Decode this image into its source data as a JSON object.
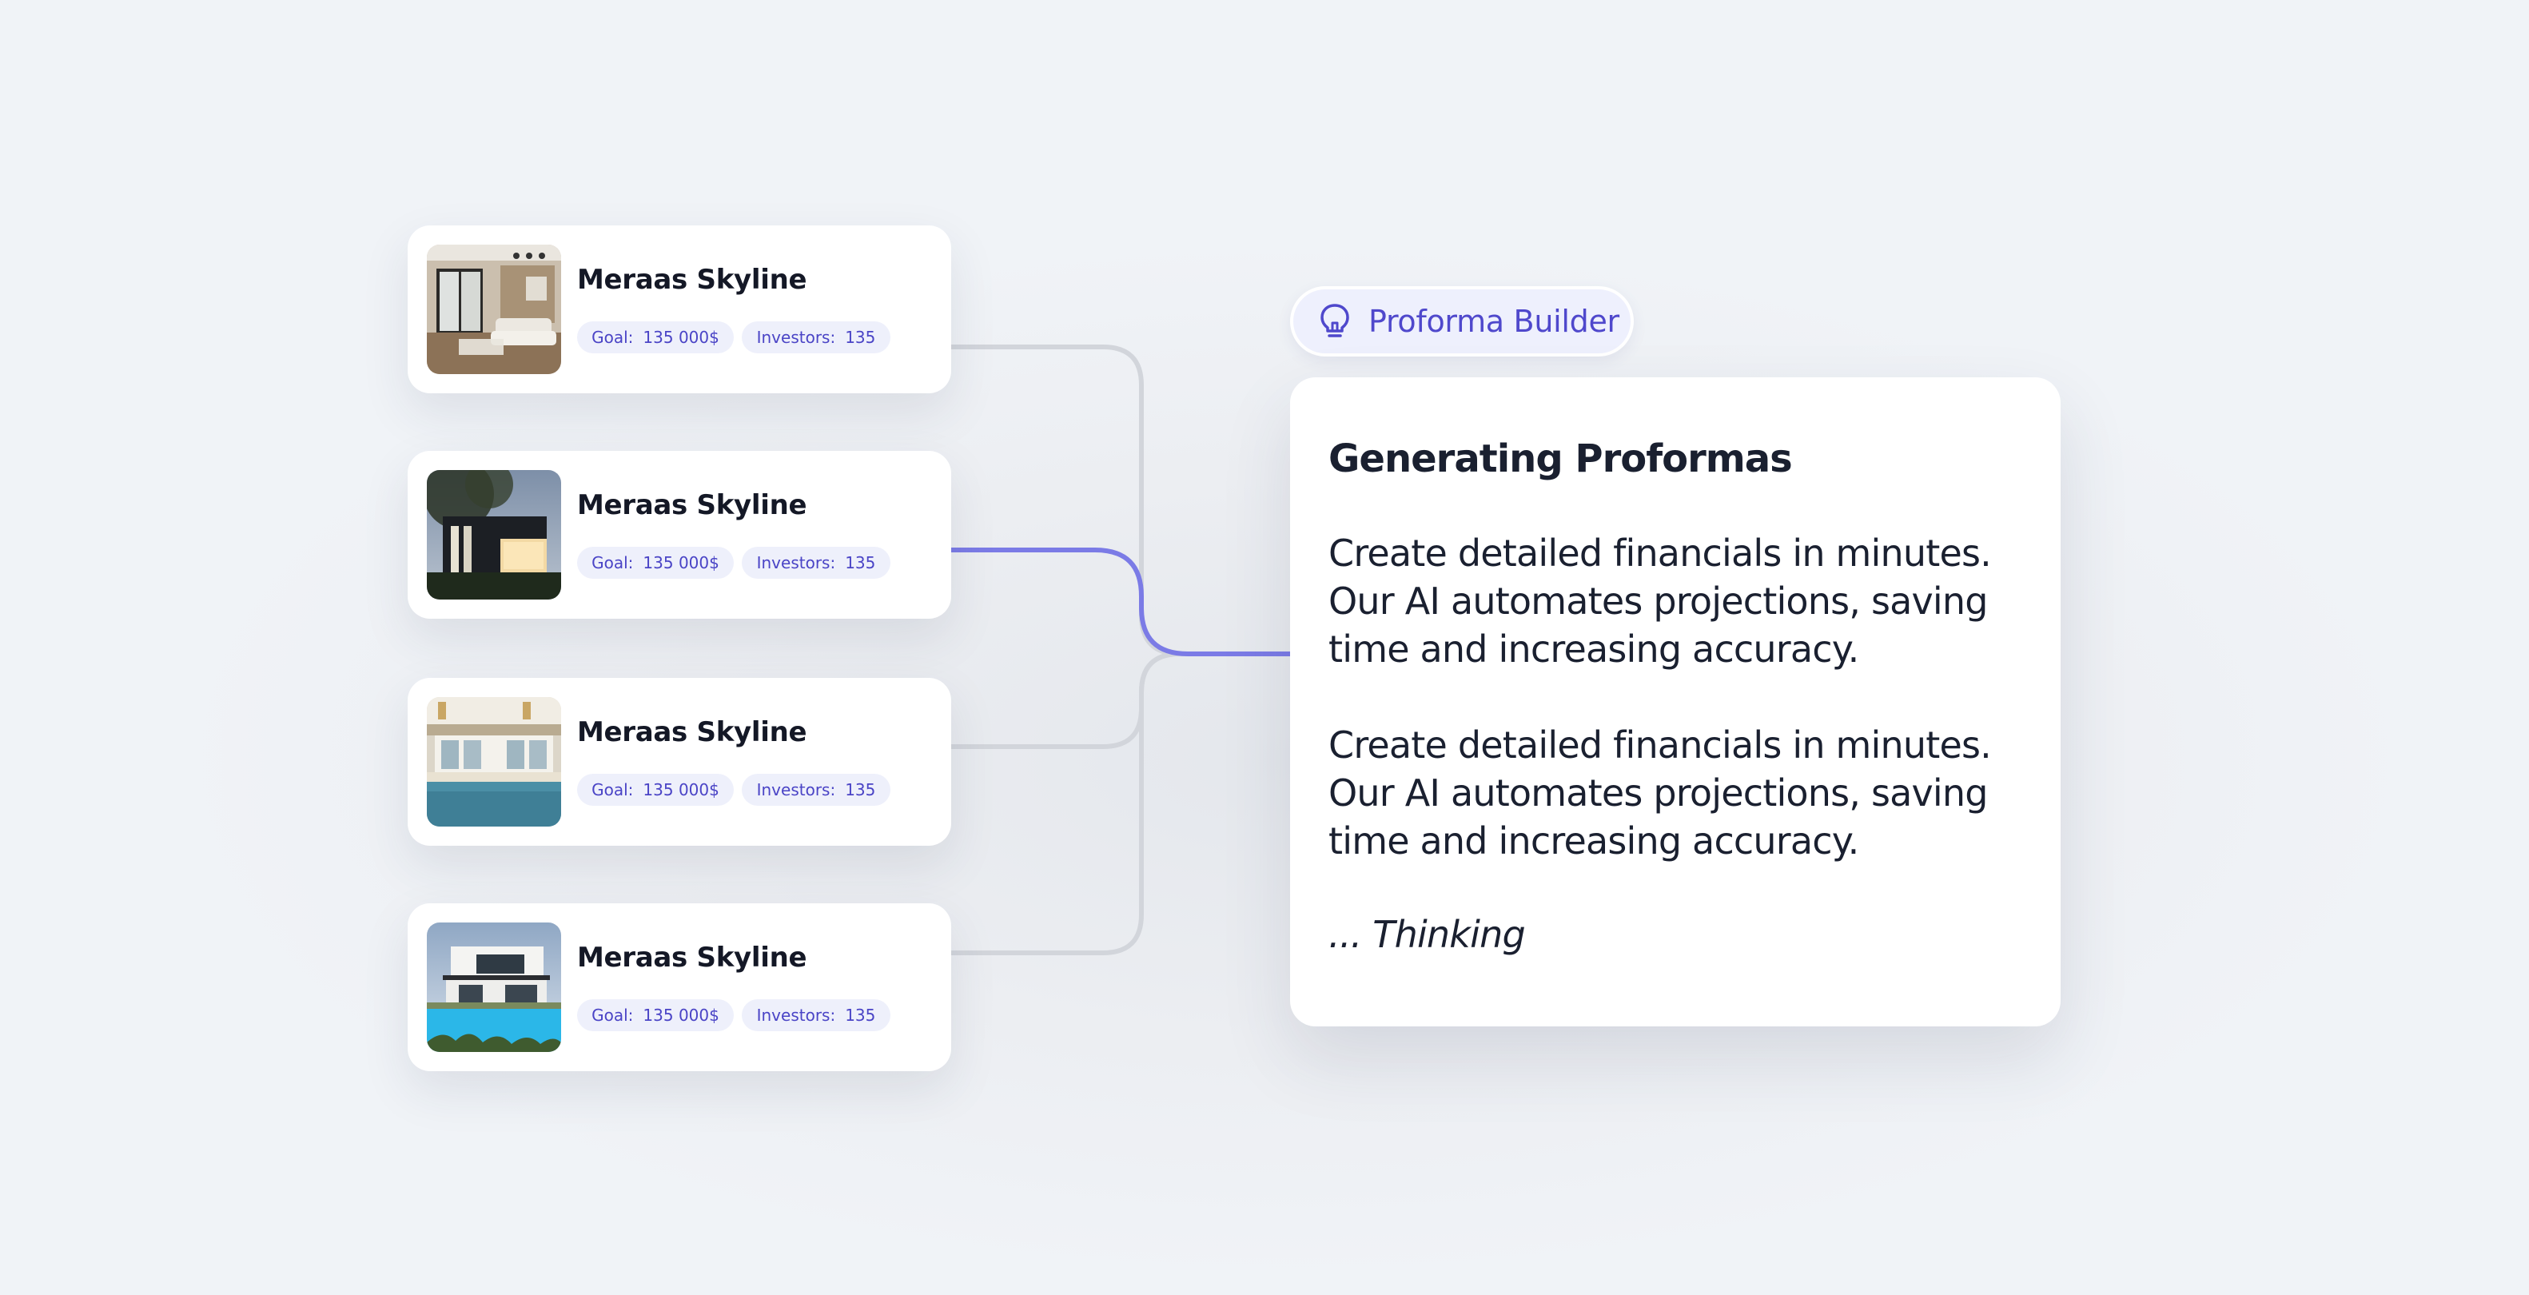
{
  "colors": {
    "accent": "#7b7be6",
    "connector_muted": "#d2d5db",
    "pill_background": "#eef0fb",
    "pill_text": "#4a44c6",
    "badge_text": "#4f48cc",
    "title_text": "#141826"
  },
  "properties": [
    {
      "title": "Meraas Skyline",
      "goal_label": "Goal:",
      "goal_value": "135 000$",
      "investors_label": "Investors:",
      "investors_value": "135",
      "image": "living-room-interior",
      "connection": "inactive"
    },
    {
      "title": "Meraas Skyline",
      "goal_label": "Goal:",
      "goal_value": "135 000$",
      "investors_label": "Investors:",
      "investors_value": "135",
      "image": "modern-house-night",
      "connection": "active"
    },
    {
      "title": "Meraas Skyline",
      "goal_label": "Goal:",
      "goal_value": "135 000$",
      "investors_label": "Investors:",
      "investors_value": "135",
      "image": "poolside-villa",
      "connection": "inactive"
    },
    {
      "title": "Meraas Skyline",
      "goal_label": "Goal:",
      "goal_value": "135 000$",
      "investors_label": "Investors:",
      "investors_value": "135",
      "image": "villa-with-pool",
      "connection": "inactive"
    }
  ],
  "badge": {
    "icon": "lightbulb-icon",
    "label": "Proforma Builder"
  },
  "panel": {
    "title": "Generating Proformas",
    "paragraphs": [
      "Create detailed financials in minutes. Our AI automates projections, saving time and increasing accuracy.",
      "Create detailed financials in minutes. Our AI automates projections, saving time and increasing accuracy."
    ],
    "status": "... Thinking"
  }
}
